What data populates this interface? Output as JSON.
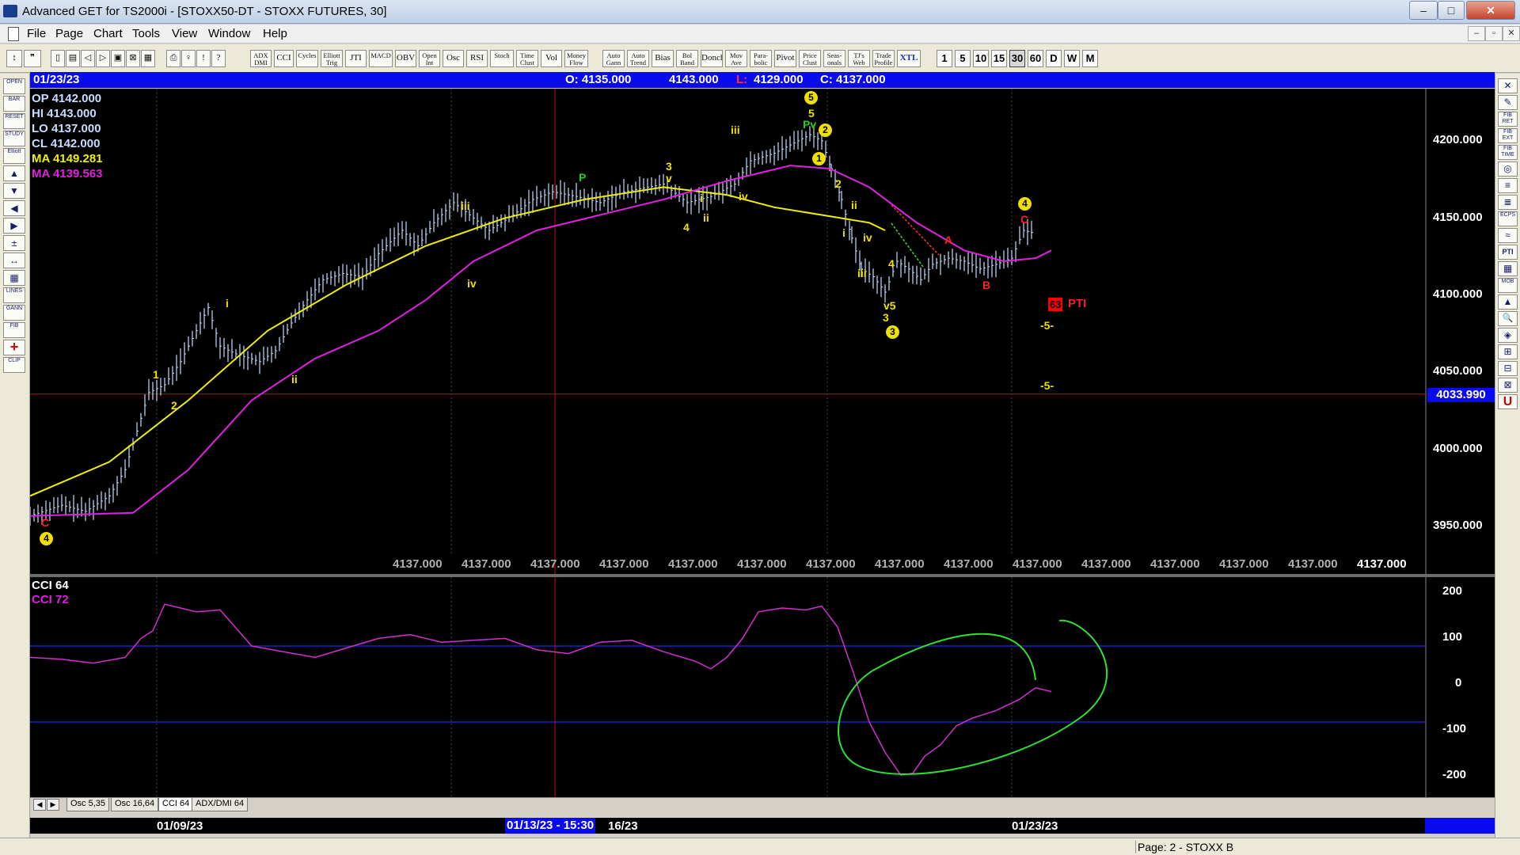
{
  "window": {
    "title": "Advanced GET for TS2000i - [STOXX50-DT - STOXX FUTURES, 30]",
    "min_glyph": "–",
    "max_glyph": "□",
    "close_glyph": "✕"
  },
  "menu": {
    "items": [
      "File",
      "Page",
      "Chart",
      "Tools",
      "View",
      "Window",
      "Help"
    ],
    "mdi_min": "–",
    "mdi_restore": "▫",
    "mdi_close": "✕"
  },
  "toolbar": {
    "study_buttons": [
      "ADX DMI",
      "CCI",
      "Cycles",
      "Elliott Trig",
      "JTI",
      "MACD",
      "OBV",
      "Open Int",
      "Osc",
      "RSI",
      "Stoch",
      "Time Clust",
      "Vol",
      "Money Flow",
      "Auto Gann",
      "Auto Trend",
      "Bias",
      "Bol Band",
      "Donch",
      "Mov Ave",
      "Para-bolic",
      "Pivot",
      "Price Clust",
      "Seas-onals",
      "TJ's Web",
      "Trade Profile",
      "XTL"
    ],
    "timeframes": [
      "1",
      "5",
      "10",
      "15",
      "30",
      "60",
      "D",
      "W",
      "M"
    ],
    "active_timeframe": "30"
  },
  "left_tools": [
    "OPEN",
    "BAR",
    "RESET",
    "STUDY",
    "Elliott",
    "▲",
    "▼",
    "◀",
    "▶",
    "±",
    "↔",
    "▦",
    "LINES",
    "GANN",
    "FIB",
    "+",
    "CLIP"
  ],
  "right_tools": [
    "✕",
    "✎",
    "FIB RET",
    "FIB EXT",
    "FIB TIME",
    "◎",
    "≡",
    "≣",
    "ECPS",
    "≈",
    "PTI",
    "▦",
    "MOB",
    "▲",
    "🔍",
    "◈",
    "⊞",
    "⊟",
    "⊠",
    "U"
  ],
  "chart_header": {
    "date": "01/23/23",
    "open": "O: 4135.000",
    "high": "4143.000",
    "low_prefix": "L:",
    "low": "4129.000",
    "close": "C: 4137.000"
  },
  "ohlc_readout": {
    "op": "OP  4142.000",
    "hi": "HI   4143.000",
    "lo": "LO  4137.000",
    "cl": "CL  4142.000",
    "ma1": "MA  4149.281",
    "ma2": "MA  4139.563"
  },
  "price_axis": [
    "4200.000",
    "4150.000",
    "4100.000",
    "4050.000",
    "4000.000",
    "3950.000"
  ],
  "price_marker": "4033.990",
  "bottom_prices": [
    "4137.000",
    "4137.000",
    "4137.000",
    "4137.000",
    "4137.000",
    "4137.000",
    "4137.000",
    "4137.000",
    "4137.000",
    "4137.000",
    "4137.000",
    "4137.000",
    "4137.000",
    "4137.000",
    "4137.000"
  ],
  "wave_labels": {
    "l_1": "1",
    "l_2": "2",
    "l_i": "i",
    "l_ii": "ii",
    "l_iii": "iii",
    "l_iv": "iv",
    "l_P": "P",
    "l_3": "3",
    "l_v": "v",
    "l_4": "4",
    "l_i2": "i",
    "l_ii2": "ii",
    "l_iii2": "iii",
    "l_iv2": "iv",
    "l_5": "5",
    "l_Pv": "Pv",
    "l_2b": "2",
    "l_i3": "i",
    "l_ii3": "ii",
    "l_iv3": "iv",
    "l_iii3": "iii",
    "l_4b": "4",
    "l_v5": "v5",
    "l_3b": "3",
    "l_A": "A",
    "l_B": "B",
    "l_C": "C",
    "l_C2": "C"
  },
  "wave_circles": {
    "c5": "5",
    "c2": "2",
    "c1": "1",
    "c3": "3",
    "c4": "4",
    "c4b": "4"
  },
  "pti": {
    "value": "63",
    "label": "PTI"
  },
  "five_markers": [
    "-5-",
    "-5-"
  ],
  "cci": {
    "label1": "CCI 64",
    "label2": "CCI  72",
    "axis": [
      "200",
      "100",
      "0",
      "-100",
      "-200"
    ]
  },
  "tabs": [
    "Osc 5,35",
    "Osc 16,64",
    "CCI 64",
    "ADX/DMI 64"
  ],
  "active_tab": "CCI 64",
  "dates": {
    "d1": "01/09/23",
    "cursor": "01/13/23 - 15:30",
    "partial": "16/23",
    "d3": "01/23/23"
  },
  "status": "Page: 2 - STOXX B",
  "colors": {
    "ma_yellow": "#f0f000",
    "ma_magenta": "#e020e0",
    "cci_line": "#d030d0",
    "annotation_green": "#30e030",
    "header_blue": "#0a0af0",
    "cursor_red": "#c01010"
  }
}
